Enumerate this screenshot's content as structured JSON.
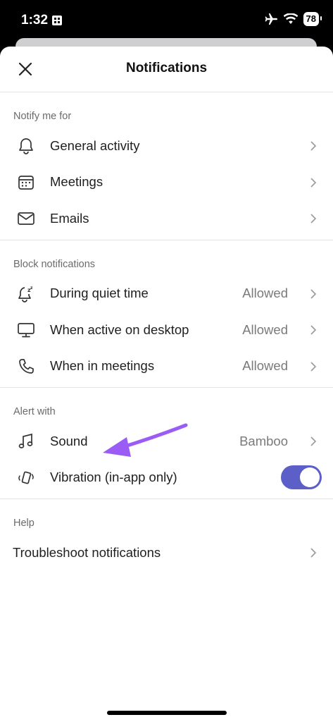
{
  "status_bar": {
    "time": "1:32",
    "battery": "78"
  },
  "header": {
    "title": "Notifications"
  },
  "sections": {
    "notify": {
      "label": "Notify me for",
      "items": [
        {
          "label": "General activity"
        },
        {
          "label": "Meetings"
        },
        {
          "label": "Emails"
        }
      ]
    },
    "block": {
      "label": "Block notifications",
      "items": [
        {
          "label": "During quiet time",
          "value": "Allowed"
        },
        {
          "label": "When active on desktop",
          "value": "Allowed"
        },
        {
          "label": "When in meetings",
          "value": "Allowed"
        }
      ]
    },
    "alert": {
      "label": "Alert with",
      "items": [
        {
          "label": "Sound",
          "value": "Bamboo"
        },
        {
          "label": "Vibration (in-app only)",
          "toggle_on": true
        }
      ]
    },
    "help": {
      "label": "Help",
      "items": [
        {
          "label": "Troubleshoot notifications"
        }
      ]
    }
  },
  "colors": {
    "accent": "#5b5fc7",
    "annotation_arrow": "#9b5cf6"
  }
}
